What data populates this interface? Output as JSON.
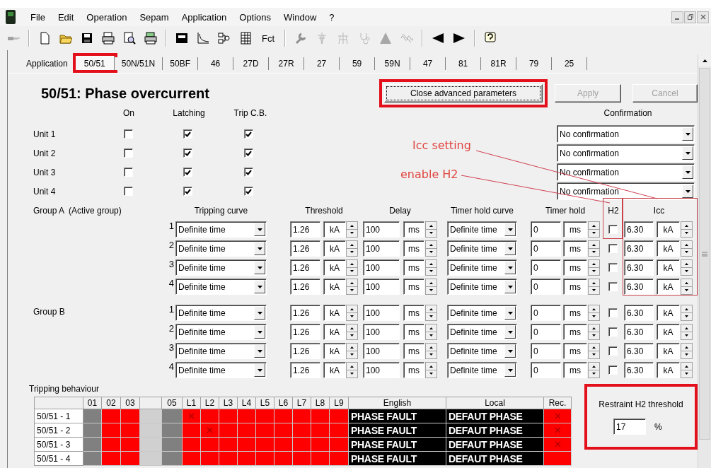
{
  "menu": [
    "File",
    "Edit",
    "Operation",
    "Sepam",
    "Application",
    "Options",
    "Window",
    "?"
  ],
  "toolbar": {
    "fct_label": "Fct"
  },
  "tabs": [
    {
      "label": "Application",
      "selected": false,
      "highlighted": false
    },
    {
      "label": "50/51",
      "selected": true,
      "highlighted": true
    },
    {
      "label": "50N/51N",
      "selected": false,
      "highlighted": false
    },
    {
      "label": "50BF",
      "selected": false,
      "highlighted": false
    },
    {
      "label": "46",
      "selected": false,
      "highlighted": false
    },
    {
      "label": "27D",
      "selected": false,
      "highlighted": false
    },
    {
      "label": "27R",
      "selected": false,
      "highlighted": false
    },
    {
      "label": "27",
      "selected": false,
      "highlighted": false
    },
    {
      "label": "59",
      "selected": false,
      "highlighted": false
    },
    {
      "label": "59N",
      "selected": false,
      "highlighted": false
    },
    {
      "label": "47",
      "selected": false,
      "highlighted": false
    },
    {
      "label": "81",
      "selected": false,
      "highlighted": false
    },
    {
      "label": "81R",
      "selected": false,
      "highlighted": false
    },
    {
      "label": "79",
      "selected": false,
      "highlighted": false
    },
    {
      "label": "25",
      "selected": false,
      "highlighted": false
    }
  ],
  "title": "50/51: Phase overcurrent",
  "buttons": [
    {
      "label": "Close advanced parameters",
      "disabled": false,
      "highlighted": true
    },
    {
      "label": "Apply",
      "disabled": true,
      "highlighted": false
    },
    {
      "label": "Cancel",
      "disabled": true,
      "highlighted": false
    }
  ],
  "unit_columns": [
    "On",
    "Latching",
    "Trip C.B."
  ],
  "confirmation_header": "Confirmation",
  "units": [
    {
      "name": "Unit 1",
      "on": false,
      "latching": true,
      "trip_cb": true,
      "confirmation": "No confirmation"
    },
    {
      "name": "Unit 2",
      "on": false,
      "latching": true,
      "trip_cb": true,
      "confirmation": "No confirmation"
    },
    {
      "name": "Unit 3",
      "on": false,
      "latching": true,
      "trip_cb": true,
      "confirmation": "No confirmation"
    },
    {
      "name": "Unit 4",
      "on": false,
      "latching": true,
      "trip_cb": true,
      "confirmation": "No confirmation"
    }
  ],
  "group_headers": [
    "Tripping curve",
    "Threshold",
    "Delay",
    "Timer hold curve",
    "Timer hold",
    "H2",
    "Icc"
  ],
  "groups": [
    {
      "label": "Group A",
      "note": "(Active group)",
      "rows": [
        {
          "number": "1",
          "curve": "Definite time",
          "threshold": "1.26",
          "threshold_unit": "kA",
          "delay": "100",
          "delay_unit": "ms",
          "hold_curve": "Definite time",
          "timer_hold": "0",
          "timer_hold_unit": "ms",
          "h2": false,
          "icc": "6.30",
          "icc_unit": "kA"
        },
        {
          "number": "2",
          "curve": "Definite time",
          "threshold": "1.26",
          "threshold_unit": "kA",
          "delay": "100",
          "delay_unit": "ms",
          "hold_curve": "Definite time",
          "timer_hold": "0",
          "timer_hold_unit": "ms",
          "h2": false,
          "icc": "6.30",
          "icc_unit": "kA"
        },
        {
          "number": "3",
          "curve": "Definite time",
          "threshold": "1.26",
          "threshold_unit": "kA",
          "delay": "100",
          "delay_unit": "ms",
          "hold_curve": "Definite time",
          "timer_hold": "0",
          "timer_hold_unit": "ms",
          "h2": false,
          "icc": "6.30",
          "icc_unit": "kA"
        },
        {
          "number": "4",
          "curve": "Definite time",
          "threshold": "1.26",
          "threshold_unit": "kA",
          "delay": "100",
          "delay_unit": "ms",
          "hold_curve": "Definite time",
          "timer_hold": "0",
          "timer_hold_unit": "ms",
          "h2": false,
          "icc": "6.30",
          "icc_unit": "kA"
        }
      ]
    },
    {
      "label": "Group B",
      "rows": [
        {
          "number": "1",
          "curve": "Definite time",
          "threshold": "1.26",
          "threshold_unit": "kA",
          "delay": "100",
          "delay_unit": "ms",
          "hold_curve": "Definite time",
          "timer_hold": "0",
          "timer_hold_unit": "ms",
          "h2": false,
          "icc": "6.30",
          "icc_unit": "kA"
        },
        {
          "number": "2",
          "curve": "Definite time",
          "threshold": "1.26",
          "threshold_unit": "kA",
          "delay": "100",
          "delay_unit": "ms",
          "hold_curve": "Definite time",
          "timer_hold": "0",
          "timer_hold_unit": "ms",
          "h2": false,
          "icc": "6.30",
          "icc_unit": "kA"
        },
        {
          "number": "3",
          "curve": "Definite time",
          "threshold": "1.26",
          "threshold_unit": "kA",
          "delay": "100",
          "delay_unit": "ms",
          "hold_curve": "Definite time",
          "timer_hold": "0",
          "timer_hold_unit": "ms",
          "h2": false,
          "icc": "6.30",
          "icc_unit": "kA"
        },
        {
          "number": "4",
          "curve": "Definite time",
          "threshold": "1.26",
          "threshold_unit": "kA",
          "delay": "100",
          "delay_unit": "ms",
          "hold_curve": "Definite time",
          "timer_hold": "0",
          "timer_hold_unit": "ms",
          "h2": false,
          "icc": "6.30",
          "icc_unit": "kA"
        }
      ]
    }
  ],
  "tripping": {
    "title": "Tripping behaviour",
    "flag_columns": [
      {
        "kind": "label",
        "label": "01"
      },
      {
        "kind": "label",
        "label": "02"
      },
      {
        "kind": "label",
        "label": "03"
      },
      {
        "kind": "spacer"
      },
      {
        "kind": "label",
        "label": "05"
      },
      {
        "kind": "label",
        "label": "L1"
      },
      {
        "kind": "label",
        "label": "L2"
      },
      {
        "kind": "label",
        "label": "L3"
      },
      {
        "kind": "label",
        "label": "L4"
      },
      {
        "kind": "label",
        "label": "L5"
      },
      {
        "kind": "label",
        "label": "L6"
      },
      {
        "kind": "label",
        "label": "L7"
      },
      {
        "kind": "label",
        "label": "L8"
      },
      {
        "kind": "label",
        "label": "L9"
      }
    ],
    "text_columns": [
      "English",
      "Local",
      "Rec."
    ],
    "rows": [
      {
        "label": "50/51 - 1",
        "english": "PHASE FAULT",
        "local": "DEFAUT PHASE",
        "recorded": true,
        "flags": [
          {
            "color": "#808080",
            "crossed": false
          },
          {
            "color": "#ff0000",
            "crossed": false
          },
          {
            "color": "#ff0000",
            "crossed": false
          },
          {
            "color": "#d0d0d0",
            "crossed": false
          },
          {
            "color": "#808080",
            "crossed": false
          },
          {
            "color": "#ff0000",
            "crossed": true
          },
          {
            "color": "#ff0000",
            "crossed": false
          },
          {
            "color": "#ff0000",
            "crossed": false
          },
          {
            "color": "#ff0000",
            "crossed": false
          },
          {
            "color": "#ff0000",
            "crossed": false
          },
          {
            "color": "#ff0000",
            "crossed": false
          },
          {
            "color": "#ff0000",
            "crossed": false
          },
          {
            "color": "#ff0000",
            "crossed": false
          },
          {
            "color": "#ff0000",
            "crossed": false
          }
        ]
      },
      {
        "label": "50/51 - 2",
        "english": "PHASE FAULT",
        "local": "DEFAUT PHASE",
        "recorded": true,
        "flags": [
          {
            "color": "#808080",
            "crossed": false
          },
          {
            "color": "#ff0000",
            "crossed": false
          },
          {
            "color": "#ff0000",
            "crossed": false
          },
          {
            "color": "#d0d0d0",
            "crossed": false
          },
          {
            "color": "#808080",
            "crossed": false
          },
          {
            "color": "#ff0000",
            "crossed": false
          },
          {
            "color": "#ff0000",
            "crossed": true
          },
          {
            "color": "#ff0000",
            "crossed": false
          },
          {
            "color": "#ff0000",
            "crossed": false
          },
          {
            "color": "#ff0000",
            "crossed": false
          },
          {
            "color": "#ff0000",
            "crossed": false
          },
          {
            "color": "#ff0000",
            "crossed": false
          },
          {
            "color": "#ff0000",
            "crossed": false
          },
          {
            "color": "#ff0000",
            "crossed": false
          }
        ]
      },
      {
        "label": "50/51 - 3",
        "english": "PHASE FAULT",
        "local": "DEFAUT PHASE",
        "recorded": true,
        "flags": [
          {
            "color": "#808080",
            "crossed": false
          },
          {
            "color": "#ff0000",
            "crossed": false
          },
          {
            "color": "#ff0000",
            "crossed": false
          },
          {
            "color": "#d0d0d0",
            "crossed": false
          },
          {
            "color": "#808080",
            "crossed": false
          },
          {
            "color": "#ff0000",
            "crossed": false
          },
          {
            "color": "#ff0000",
            "crossed": false
          },
          {
            "color": "#ff0000",
            "crossed": false
          },
          {
            "color": "#ff0000",
            "crossed": false
          },
          {
            "color": "#ff0000",
            "crossed": false
          },
          {
            "color": "#ff0000",
            "crossed": false
          },
          {
            "color": "#ff0000",
            "crossed": false
          },
          {
            "color": "#ff0000",
            "crossed": false
          },
          {
            "color": "#ff0000",
            "crossed": false
          }
        ]
      },
      {
        "label": "50/51 - 4",
        "english": "PHASE FAULT",
        "local": "DEFAUT PHASE",
        "recorded": false,
        "flags": [
          {
            "color": "#808080",
            "crossed": false
          },
          {
            "color": "#ff0000",
            "crossed": false
          },
          {
            "color": "#ff0000",
            "crossed": false
          },
          {
            "color": "#d0d0d0",
            "crossed": false
          },
          {
            "color": "#808080",
            "crossed": false
          },
          {
            "color": "#ff0000",
            "crossed": false
          },
          {
            "color": "#ff0000",
            "crossed": false
          },
          {
            "color": "#ff0000",
            "crossed": false
          },
          {
            "color": "#ff0000",
            "crossed": false
          },
          {
            "color": "#ff0000",
            "crossed": false
          },
          {
            "color": "#ff0000",
            "crossed": false
          },
          {
            "color": "#ff0000",
            "crossed": false
          },
          {
            "color": "#ff0000",
            "crossed": false
          },
          {
            "color": "#ff0000",
            "crossed": false
          }
        ]
      }
    ]
  },
  "restraint": {
    "title": "Restraint H2 threshold",
    "value": "17",
    "unit": "%",
    "highlighted": true
  },
  "annotations": [
    {
      "text": "Icc setting"
    },
    {
      "text": "enable H2"
    }
  ]
}
